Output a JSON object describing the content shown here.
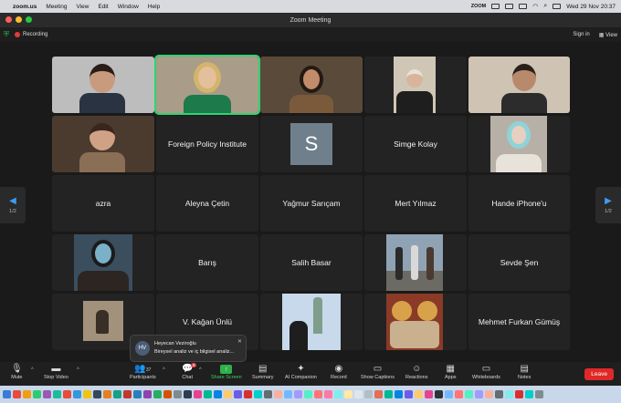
{
  "menubar": {
    "app": "zoom.us",
    "items": [
      "Meeting",
      "View",
      "Edit",
      "Window",
      "Help"
    ],
    "clock": "Wed 29 Nov  20:37",
    "status_app": "ZOOM"
  },
  "window": {
    "title": "Zoom Meeting"
  },
  "topstrip": {
    "recording": "Recording",
    "sign_in": "Sign in",
    "view": "View"
  },
  "pager": {
    "left_label": "1/2",
    "right_label": "1/2"
  },
  "tiles": {
    "foreign_policy": "Foreign Policy Institute",
    "s_avatar": "S",
    "simge": "Simge Kolay",
    "azra": "azra",
    "aleyna": "Aleyna Çetin",
    "yagmur": "Yağmur Sarıçam",
    "mert": "Mert Yılmaz",
    "hande": "Hande iPhone'u",
    "baris": "Barış",
    "salih": "Salih Basar",
    "sevde": "Sevde Şen",
    "kagan": "V. Kağan Ünlü",
    "mehmet": "Mehmet Furkan Gümüş"
  },
  "toast": {
    "initials": "HV",
    "name": "Heyecan Veziroğlu",
    "message": "Bireysel analiz ve iç bilgisel analiz..."
  },
  "toolbar": {
    "mute": "Mute",
    "stop_video": "Stop Video",
    "participants": "Participants",
    "participants_count": "37",
    "chat": "Chat",
    "chat_badge": "8",
    "share": "Share Screen",
    "summary": "Summary",
    "ai": "AI Companion",
    "record": "Record",
    "captions": "Show Captions",
    "reactions": "Reactions",
    "apps": "Apps",
    "whiteboards": "Whiteboards",
    "notes": "Notes",
    "leave": "Leave"
  }
}
